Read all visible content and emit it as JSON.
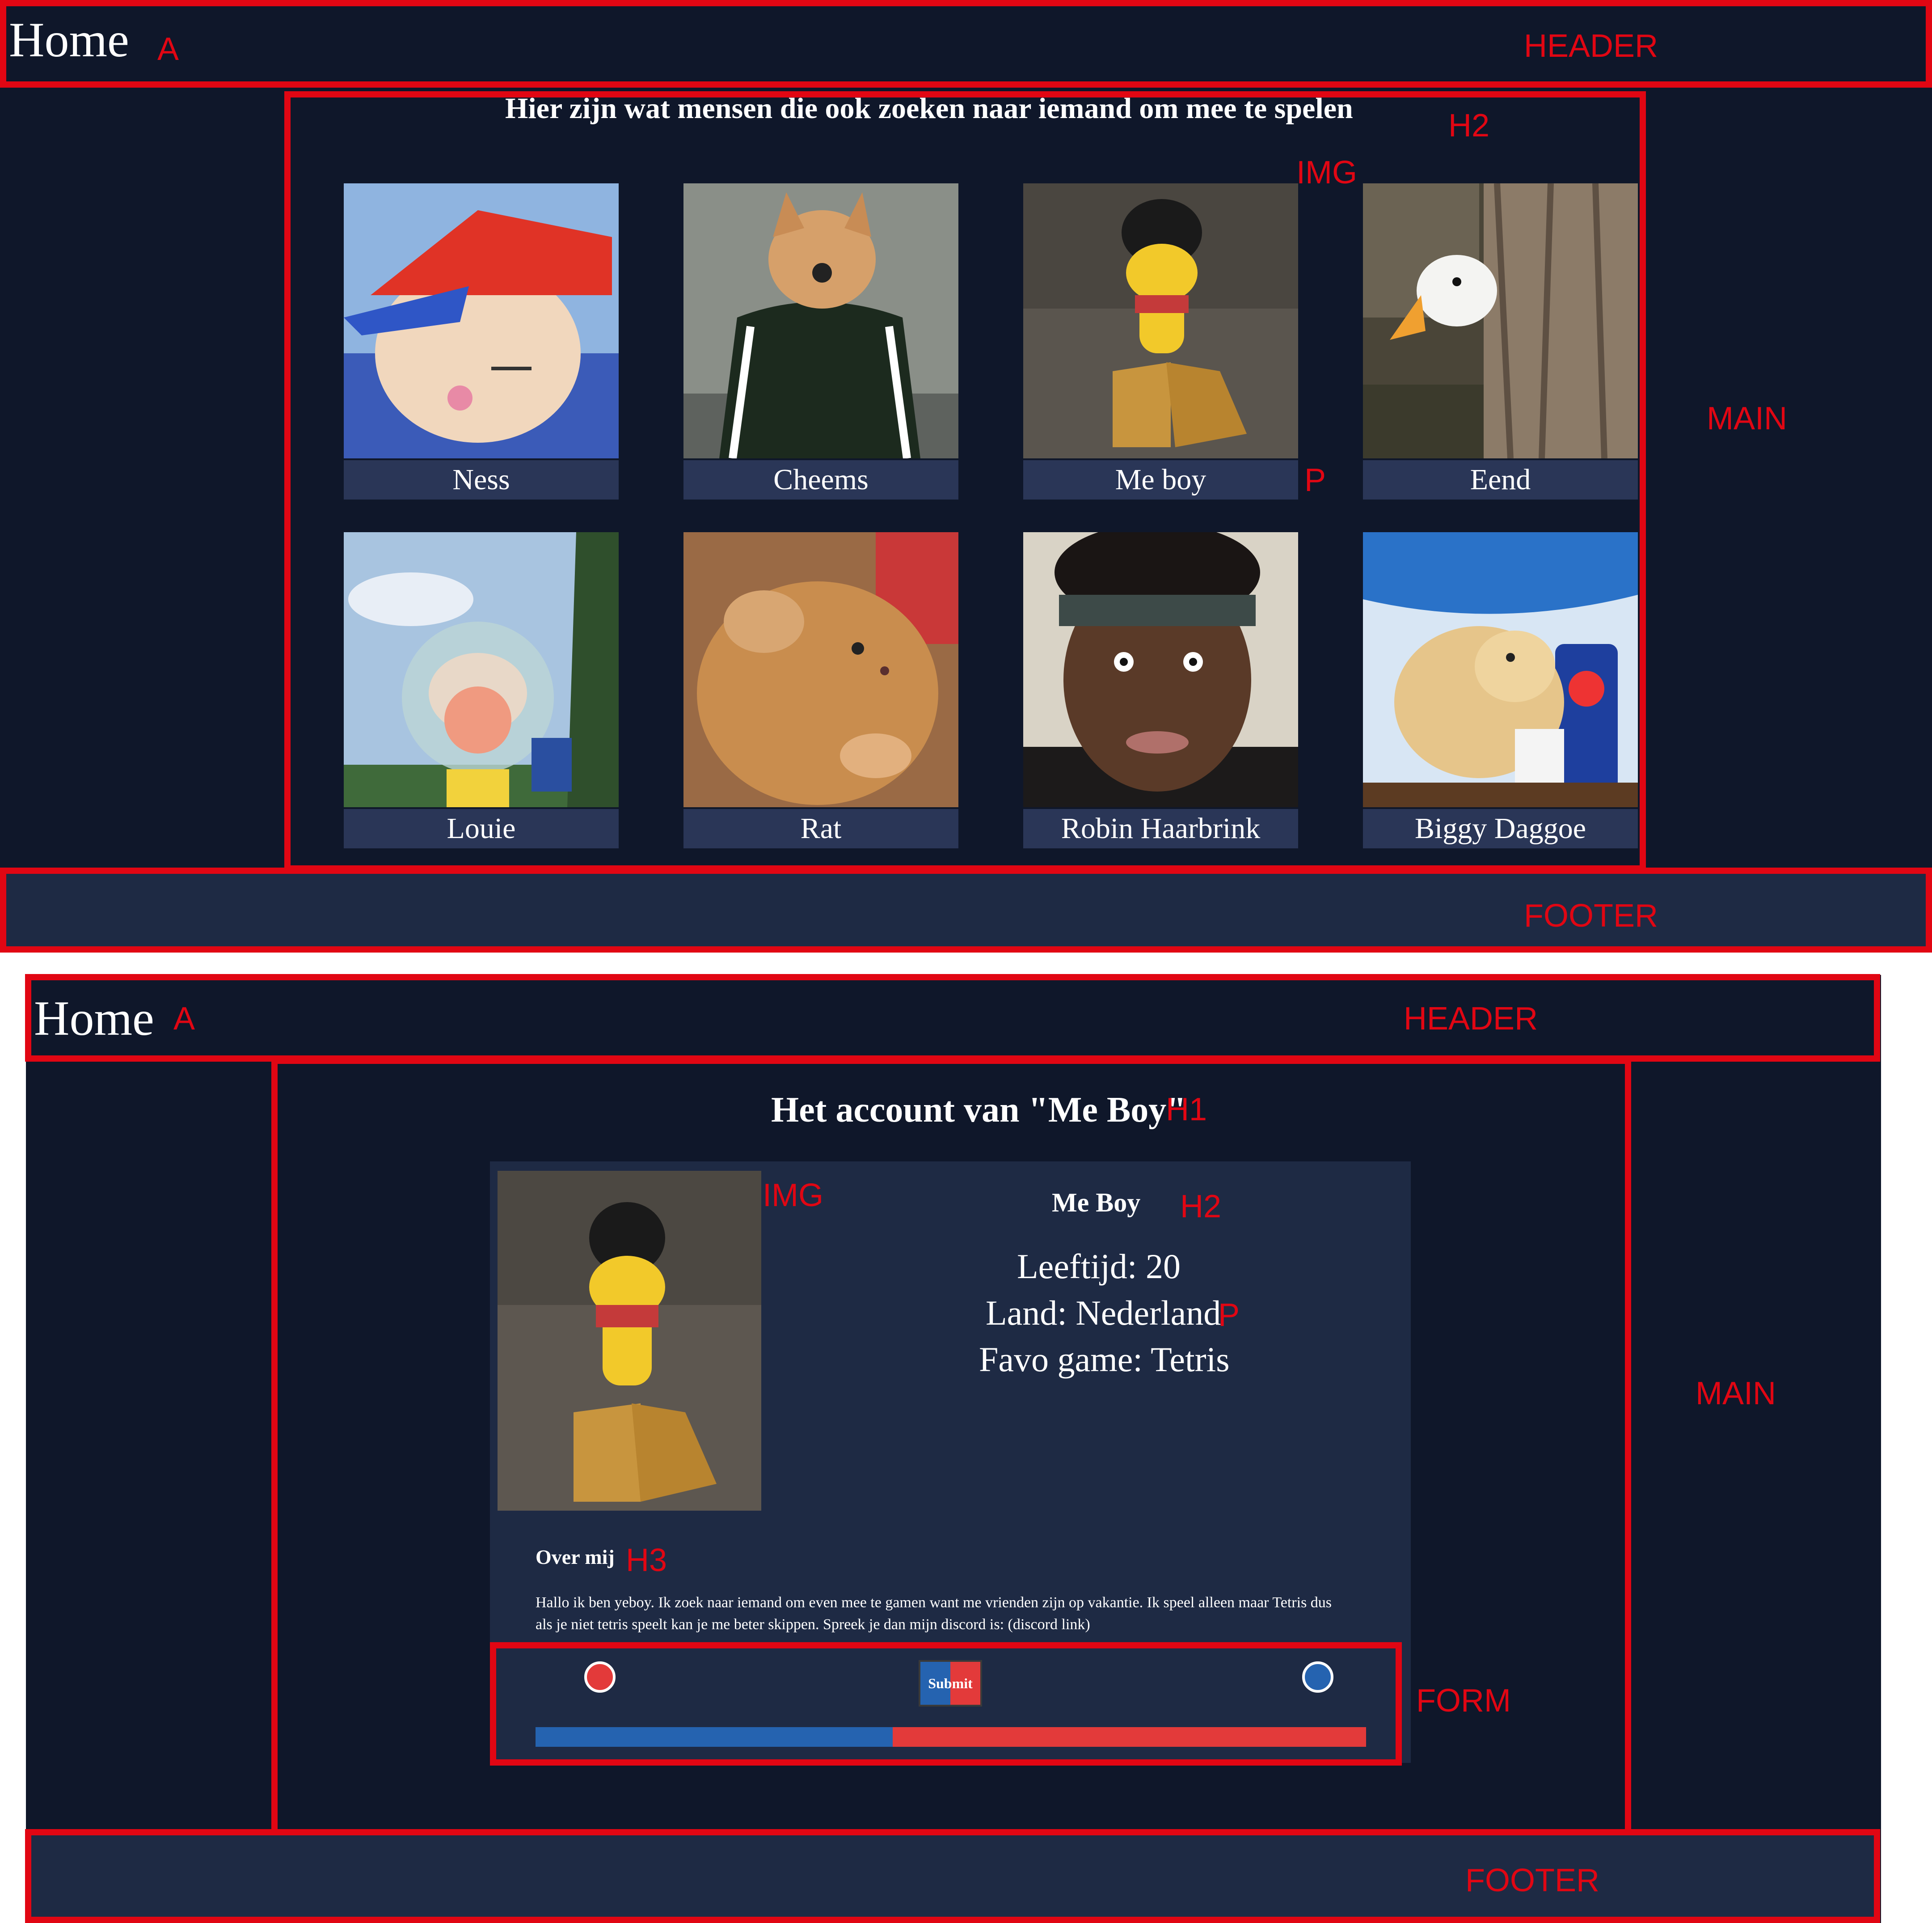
{
  "screen1": {
    "header": {
      "home_link": "Home",
      "label_a": "A",
      "label_header": "HEADER"
    },
    "main": {
      "heading": "Hier zijn wat mensen die ook zoeken naar iemand om mee te spelen",
      "label_h2": "H2",
      "label_img": "IMG",
      "label_p": "P",
      "label_main": "MAIN",
      "profiles": [
        {
          "name": "Ness"
        },
        {
          "name": "Cheems"
        },
        {
          "name": "Me boy"
        },
        {
          "name": "Eend"
        },
        {
          "name": "Louie"
        },
        {
          "name": "Rat"
        },
        {
          "name": "Robin Haarbrink"
        },
        {
          "name": "Biggy Daggoe"
        }
      ]
    },
    "footer": {
      "label_footer": "FOOTER"
    }
  },
  "screen2": {
    "header": {
      "home_link": "Home",
      "label_a": "A",
      "label_header": "HEADER"
    },
    "main": {
      "title": "Het account van \"Me Boy\"",
      "label_h1": "H1",
      "label_img": "IMG",
      "label_h2": "H2",
      "label_p": "P",
      "label_h3": "H3",
      "label_main": "MAIN",
      "label_form": "FORM",
      "profile_name": "Me Boy",
      "age": "Leeftijd: 20",
      "country": "Land: Nederland",
      "favorite_game": "Favo game: Tetris",
      "about_heading": "Over mij",
      "about_line1": "Hallo ik ben yeboy. Ik zoek naar iemand om even mee te gamen want me vrienden zijn op vakantie. Ik speel alleen maar Tetris dus",
      "about_line2": "als je niet tetris speelt kan je me beter skippen. Spreek je dan mijn discord is: (discord link)",
      "submit_label": "Submit",
      "slider_value_fraction": 0.43
    },
    "footer": {
      "label_footer": "FOOTER"
    }
  },
  "colors": {
    "page_bg": "#0f172a",
    "panel": "#1e2a44",
    "annotation": "#e10613",
    "blue": "#2563b0",
    "red": "#e33a3a"
  }
}
